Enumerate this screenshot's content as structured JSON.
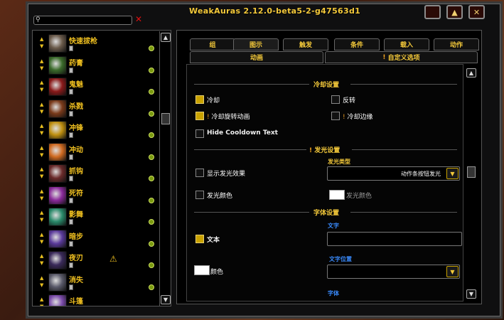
{
  "window": {
    "title": "WeakAuras 2.12.0-beta5-2-g47563d1"
  },
  "title_buttons": [
    {
      "name": "minimize-icon",
      "glyph": ""
    },
    {
      "name": "collapse-icon",
      "glyph": "▲"
    },
    {
      "name": "close-icon",
      "glyph": "✕"
    }
  ],
  "search": {
    "placeholder": "",
    "clear_glyph": "✕",
    "icon_glyph": "⚲"
  },
  "aura_list": [
    {
      "label": "快速拔枪",
      "color": "#6a5a4a",
      "warning": false
    },
    {
      "label": "药膏",
      "color": "#3a6a2a",
      "warning": false
    },
    {
      "label": "鬼魅",
      "color": "#8a1a1a",
      "warning": false
    },
    {
      "label": "杀戮",
      "color": "#7a3a1a",
      "warning": false
    },
    {
      "label": "冲锋",
      "color": "#c09010",
      "warning": false
    },
    {
      "label": "冲动",
      "color": "#d06a20",
      "warning": false
    },
    {
      "label": "抓钩",
      "color": "#6a2a2a",
      "warning": false
    },
    {
      "label": "死符",
      "color": "#8a2a9a",
      "warning": false
    },
    {
      "label": "影舞",
      "color": "#2a8a6a",
      "warning": false
    },
    {
      "label": "暗步",
      "color": "#5a3a9a",
      "warning": false
    },
    {
      "label": "夜刃",
      "color": "#3a2a5a",
      "warning": true
    },
    {
      "label": "消失",
      "color": "#5a5a6a",
      "warning": false
    },
    {
      "label": "斗篷",
      "color": "#7a4aaa",
      "warning": false
    }
  ],
  "tabs_row1": [
    "组",
    "图示",
    "触发",
    "条件",
    "载入",
    "动作"
  ],
  "tabs_row2": [
    {
      "label": "动画",
      "warn": false
    },
    {
      "label": "自定义选项",
      "warn": true
    }
  ],
  "sections": {
    "cooldown": {
      "header": "冷却设置",
      "cooldown": {
        "label": "冷却",
        "checked": true
      },
      "reverse": {
        "label": "反转",
        "checked": false
      },
      "swipe": {
        "label": "冷却旋转动画",
        "checked": true,
        "warn": true
      },
      "edge": {
        "label": "冷却边缘",
        "checked": false,
        "warn": true
      },
      "hide_text": {
        "label": "Hide Cooldown Text",
        "checked": false
      }
    },
    "glow": {
      "header": "发光设置",
      "show": {
        "label": "显示发光效果",
        "checked": false
      },
      "type_label": "发光类型",
      "type_value": "动作条按钮发光",
      "color": {
        "label": "发光颜色",
        "checked": false
      },
      "color_swatch_label": "发光颜色",
      "swatch_color": "#ffffff"
    },
    "font": {
      "header": "字体设置",
      "text": {
        "label": "文本",
        "checked": true
      },
      "text_field_label": "文字",
      "text_value": "",
      "color_label": "颜色",
      "position_label": "文字位置",
      "position_value": "",
      "font_label": "字体"
    }
  },
  "colors": {
    "accent": "#f4c93a",
    "link": "#3a8cff",
    "checkbox_on": "#c9a200"
  }
}
